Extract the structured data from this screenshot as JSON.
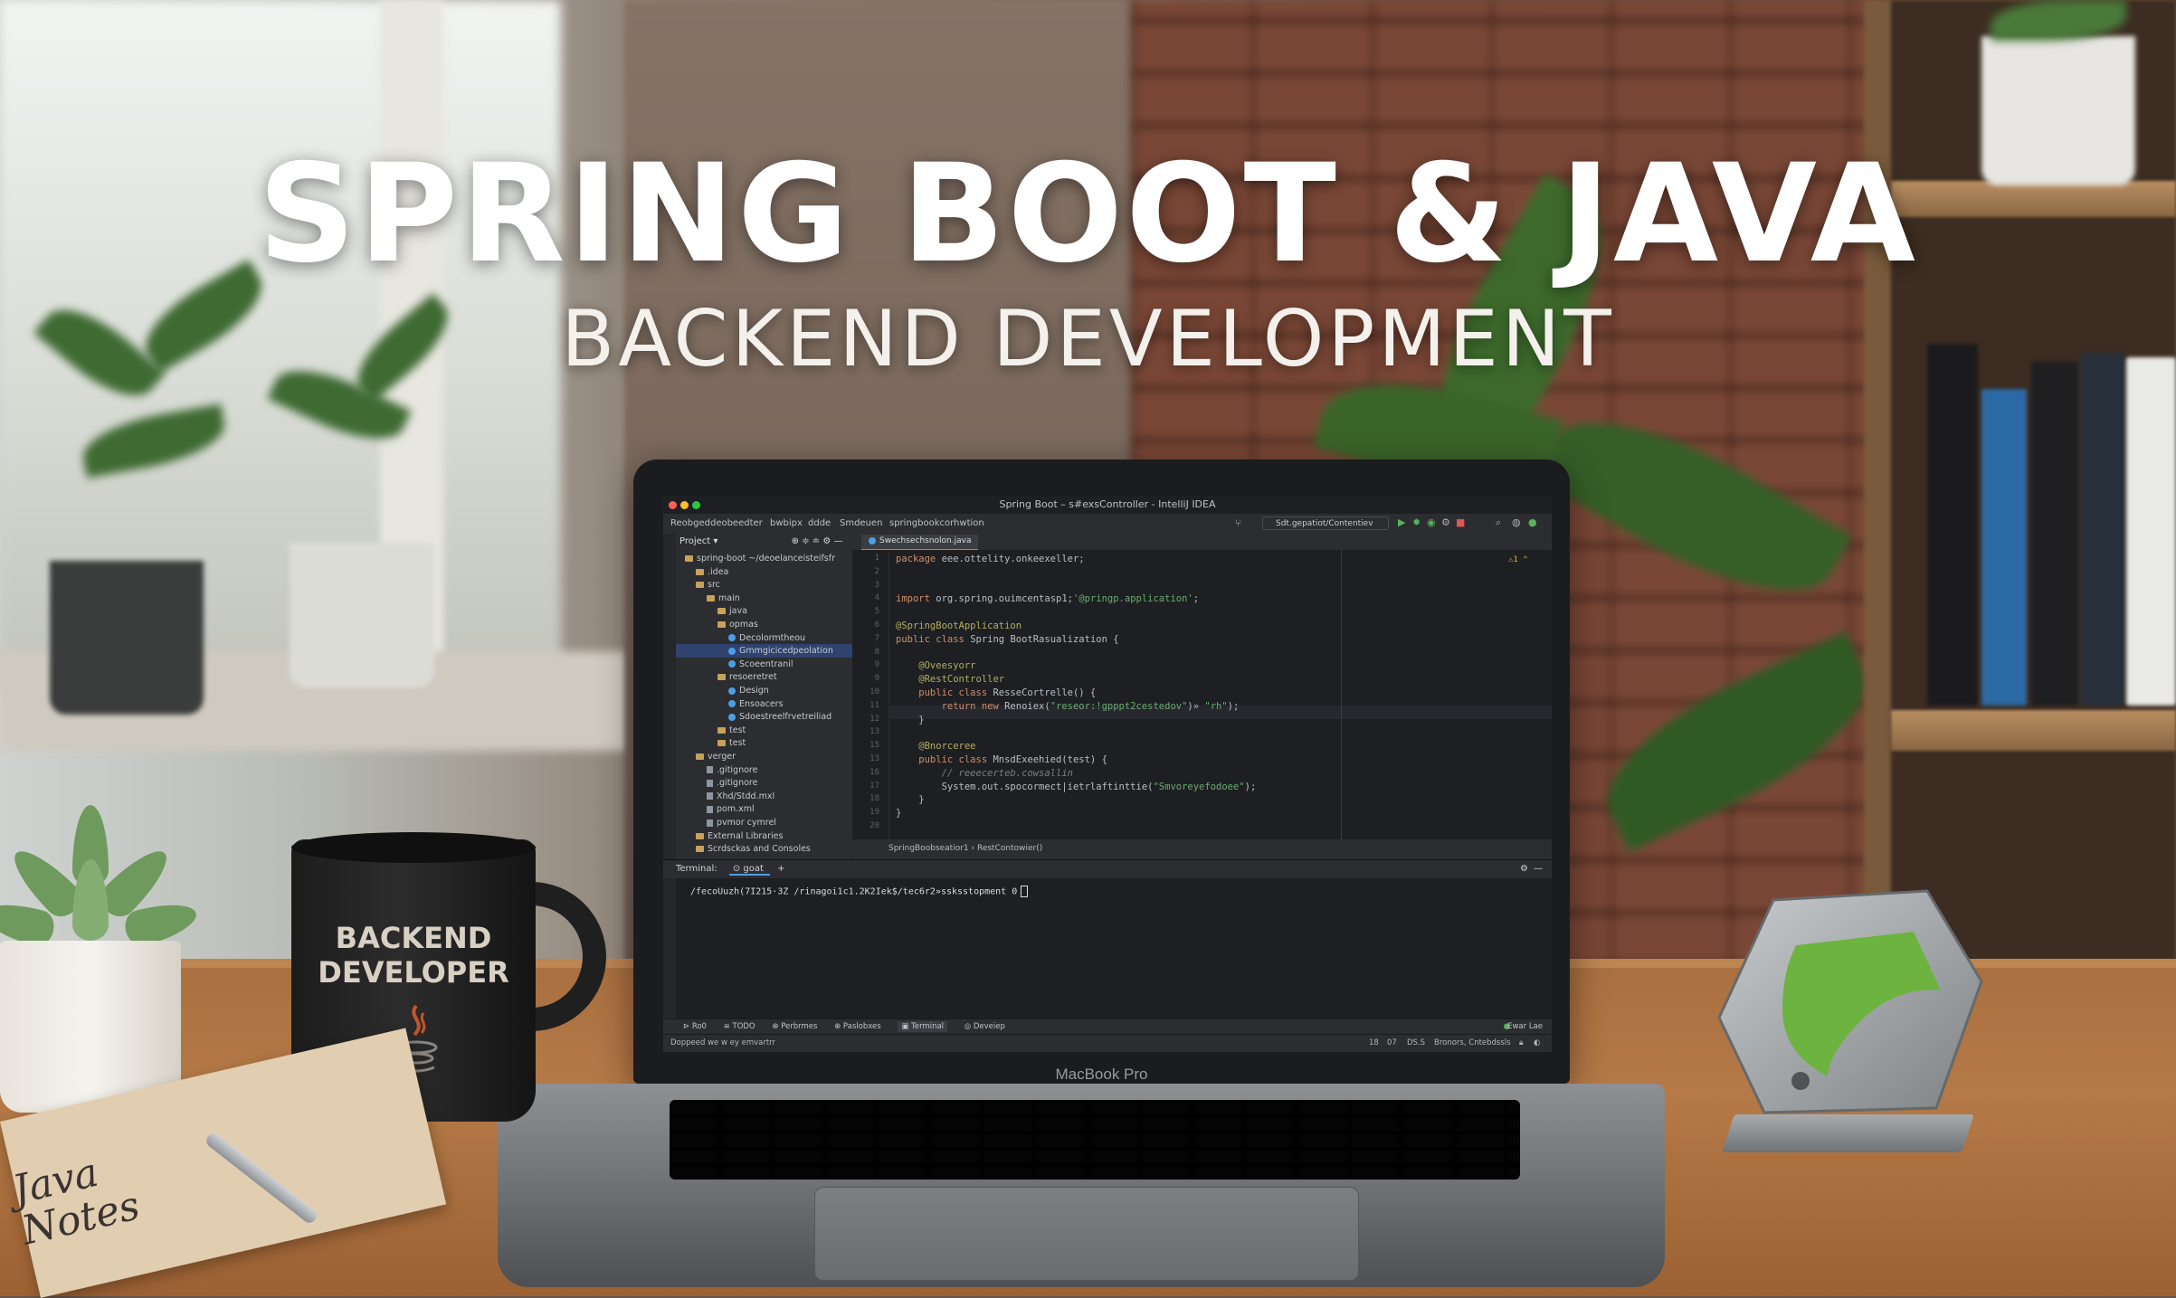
{
  "hero": {
    "title": "SPRING BOOT & JAVA",
    "subtitle": "BACKEND DEVELOPMENT"
  },
  "ide": {
    "window_title": "Spring Boot – s#exsController - IntelliJ IDEA",
    "breadcrumbs": [
      "Reobgeddeobeedter",
      "bwbipx",
      "ddde",
      "Smdeuen",
      "springbookcorhwtion"
    ],
    "run_config": "Sdt.gepatiot/Contentiev",
    "project_panel_label": "Project",
    "tree": [
      {
        "depth": 0,
        "label": "spring-boot ~/deoelanceisteifsfr",
        "kind": "folder",
        "selected": false
      },
      {
        "depth": 1,
        "label": ".idea",
        "kind": "folder",
        "selected": false
      },
      {
        "depth": 1,
        "label": "src",
        "kind": "folder",
        "selected": false
      },
      {
        "depth": 2,
        "label": "main",
        "kind": "folder",
        "selected": false
      },
      {
        "depth": 3,
        "label": "java",
        "kind": "folder",
        "selected": false
      },
      {
        "depth": 3,
        "label": "opmas",
        "kind": "folder",
        "selected": false
      },
      {
        "depth": 4,
        "label": "Decolormtheou",
        "kind": "class",
        "selected": false
      },
      {
        "depth": 4,
        "label": "Gmmgicicedpeolation",
        "kind": "class",
        "selected": true
      },
      {
        "depth": 4,
        "label": "Scoeentranil",
        "kind": "class",
        "selected": false
      },
      {
        "depth": 3,
        "label": "resoeretret",
        "kind": "folder",
        "selected": false
      },
      {
        "depth": 4,
        "label": "Design",
        "kind": "class",
        "selected": false
      },
      {
        "depth": 4,
        "label": "Ensoacers",
        "kind": "class",
        "selected": false
      },
      {
        "depth": 4,
        "label": "Sdoestreelfrvetreiliad",
        "kind": "class",
        "selected": false
      },
      {
        "depth": 3,
        "label": "test",
        "kind": "folder",
        "selected": false
      },
      {
        "depth": 3,
        "label": "test",
        "kind": "folder",
        "selected": false
      },
      {
        "depth": 1,
        "label": "verger",
        "kind": "folder",
        "selected": false
      },
      {
        "depth": 2,
        "label": ".gitignore",
        "kind": "file",
        "selected": false
      },
      {
        "depth": 2,
        "label": ".gitignore",
        "kind": "file",
        "selected": false
      },
      {
        "depth": 2,
        "label": "Xhd/Stdd.mxl",
        "kind": "file",
        "selected": false
      },
      {
        "depth": 2,
        "label": "pom.xml",
        "kind": "file",
        "selected": false
      },
      {
        "depth": 2,
        "label": "pvmor cymrel",
        "kind": "file",
        "selected": false
      },
      {
        "depth": 1,
        "label": "External Libraries",
        "kind": "folder",
        "selected": false
      },
      {
        "depth": 1,
        "label": "Scrdsckas and Consoles",
        "kind": "folder",
        "selected": false
      }
    ],
    "editor_tab": "Swechsechsnolon.java",
    "warning_badge": "⚠1 ⌃",
    "code_lines": [
      {
        "n": "1",
        "parts": [
          [
            "kw",
            "package "
          ],
          [
            "tx",
            "eee.ottelity.onkeexeller;"
          ]
        ]
      },
      {
        "n": "2",
        "parts": []
      },
      {
        "n": "3",
        "parts": []
      },
      {
        "n": "4",
        "parts": [
          [
            "kw",
            "import "
          ],
          [
            "tx",
            "org.spring.ouimcentasp1;"
          ],
          [
            "st",
            "'@pringp.application'"
          ],
          [
            "tx",
            ";"
          ]
        ]
      },
      {
        "n": "5",
        "parts": []
      },
      {
        "n": "6",
        "parts": [
          [
            "an",
            "@SpringBootApplication"
          ]
        ]
      },
      {
        "n": "7",
        "parts": [
          [
            "kw",
            "public class "
          ],
          [
            "tx",
            "Spring BootRasualization {"
          ]
        ]
      },
      {
        "n": "8",
        "parts": []
      },
      {
        "n": "9",
        "parts": [
          [
            "an",
            "    @Oveesyorr"
          ]
        ]
      },
      {
        "n": "9",
        "parts": [
          [
            "an",
            "    @RestController"
          ]
        ]
      },
      {
        "n": "10",
        "parts": [
          [
            "kw",
            "    public class "
          ],
          [
            "tx",
            "ResseCortrelle() {"
          ]
        ]
      },
      {
        "n": "11",
        "parts": [
          [
            "kw",
            "        return new "
          ],
          [
            "tx",
            "Renoiex("
          ],
          [
            "st",
            "\"reseor:!gpppt2cestedov\""
          ],
          [
            "tx",
            ")» "
          ],
          [
            "st",
            "\"rh\""
          ],
          [
            "tx",
            ");"
          ]
        ]
      },
      {
        "n": "12",
        "parts": [
          [
            "tx",
            "    }"
          ]
        ]
      },
      {
        "n": "13",
        "parts": []
      },
      {
        "n": "15",
        "parts": [
          [
            "an",
            "    @Bnorceree"
          ]
        ]
      },
      {
        "n": "13",
        "parts": [
          [
            "kw",
            "    public class "
          ],
          [
            "tx",
            "MnsdExeehied(test) {"
          ]
        ]
      },
      {
        "n": "16",
        "parts": [
          [
            "cm",
            "        // reeecerteb.cowsallin"
          ]
        ]
      },
      {
        "n": "17",
        "parts": [
          [
            "tx",
            "        System.out.spocormect|ietrlaftinttie("
          ],
          [
            "st",
            "\"Smvoreyefodoee\""
          ],
          [
            "tx",
            ");"
          ]
        ]
      },
      {
        "n": "18",
        "parts": [
          [
            "tx",
            "    }"
          ]
        ]
      },
      {
        "n": "19",
        "parts": [
          [
            "tx",
            "}"
          ]
        ]
      },
      {
        "n": "20",
        "parts": []
      }
    ],
    "editor_breadcrumb": "SpringBoobseatior1  ›  RestContowier()",
    "terminal_label": "Terminal:",
    "terminal_tab": "goat",
    "terminal_line": "/fecoUuzh(7I215·3Z /rinagoi1c1.2K2Iek$/tec6r2»ssksstopment 0",
    "tool_tabs": [
      "⊳ Ro0",
      "≡ TODO",
      "⊕ Perbrmes",
      "⊕ Paslobxes",
      "▣ Terminal",
      "◎ Deveiep"
    ],
    "status_left": "Doppeed we w ey emvartrr",
    "status_right": [
      "18",
      "07",
      "DS.S",
      "Bronors, Cntebdssls"
    ],
    "status_event": "Ewar Lae"
  },
  "laptop": {
    "model": "MacBook Pro"
  },
  "mug": {
    "line1": "BACKEND",
    "line2": "DEVELOPER"
  },
  "notebook": {
    "line1": "Java",
    "line2": "Notes"
  },
  "colors": {
    "spring_green": "#6db33f",
    "ide_bg": "#1e1f22",
    "keyword": "#cf8e6d",
    "annotation": "#b3ae60",
    "string": "#6aab73"
  }
}
